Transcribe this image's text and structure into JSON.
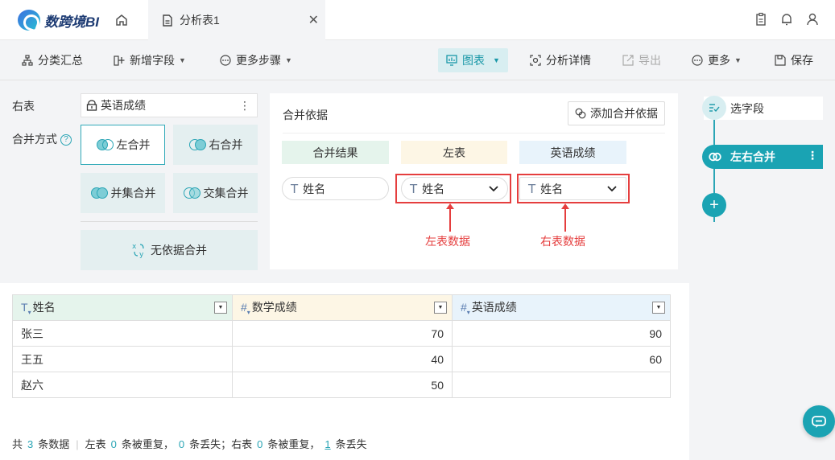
{
  "app": {
    "name": "数跨境BI"
  },
  "tab": {
    "label": "分析表1"
  },
  "toolbar": {
    "group_summary": "分类汇总",
    "add_field": "新增字段",
    "more_steps": "更多步骤",
    "chart": "图表",
    "analysis_detail": "分析详情",
    "export": "导出",
    "more": "更多",
    "save": "保存"
  },
  "config": {
    "right_table_label": "右表",
    "right_table_value": "英语成绩",
    "merge_method_label": "合并方式",
    "methods": {
      "left": "左合并",
      "right": "右合并",
      "union": "并集合并",
      "intersect": "交集合并",
      "none": "无依据合并"
    }
  },
  "basis": {
    "title": "合并依据",
    "add_button": "添加合并依据",
    "headers": {
      "result": "合并结果",
      "left": "左表",
      "right": "英语成绩"
    },
    "result_field": "姓名",
    "left_field": "姓名",
    "right_field": "姓名",
    "annot_left": "左表数据",
    "annot_right": "右表数据",
    "colors": {
      "result_bg": "#e5f4ec",
      "left_bg": "#fdf6e5",
      "right_bg": "#e8f3fb",
      "annotation": "#e53e3e"
    }
  },
  "table": {
    "headers": [
      "姓名",
      "数学成绩",
      "英语成绩"
    ],
    "header_icons": [
      "T",
      "#",
      "#"
    ],
    "rows": [
      [
        "张三",
        "70",
        "90"
      ],
      [
        "王五",
        "40",
        "60"
      ],
      [
        "赵六",
        "50",
        ""
      ]
    ]
  },
  "stats": {
    "p1": "共",
    "total": "3",
    "p2": "条数据",
    "p3": "左表",
    "left_dup": "0",
    "p4": "条被重复，",
    "left_lost": "0",
    "p5": "条丢失；右表",
    "right_dup": "0",
    "p6": "条被重复，",
    "right_lost": "1",
    "p7": "条丢失"
  },
  "flow": {
    "select_fields": "选字段",
    "lr_merge": "左右合并",
    "add": "+"
  },
  "accent": "#1aa3b3"
}
